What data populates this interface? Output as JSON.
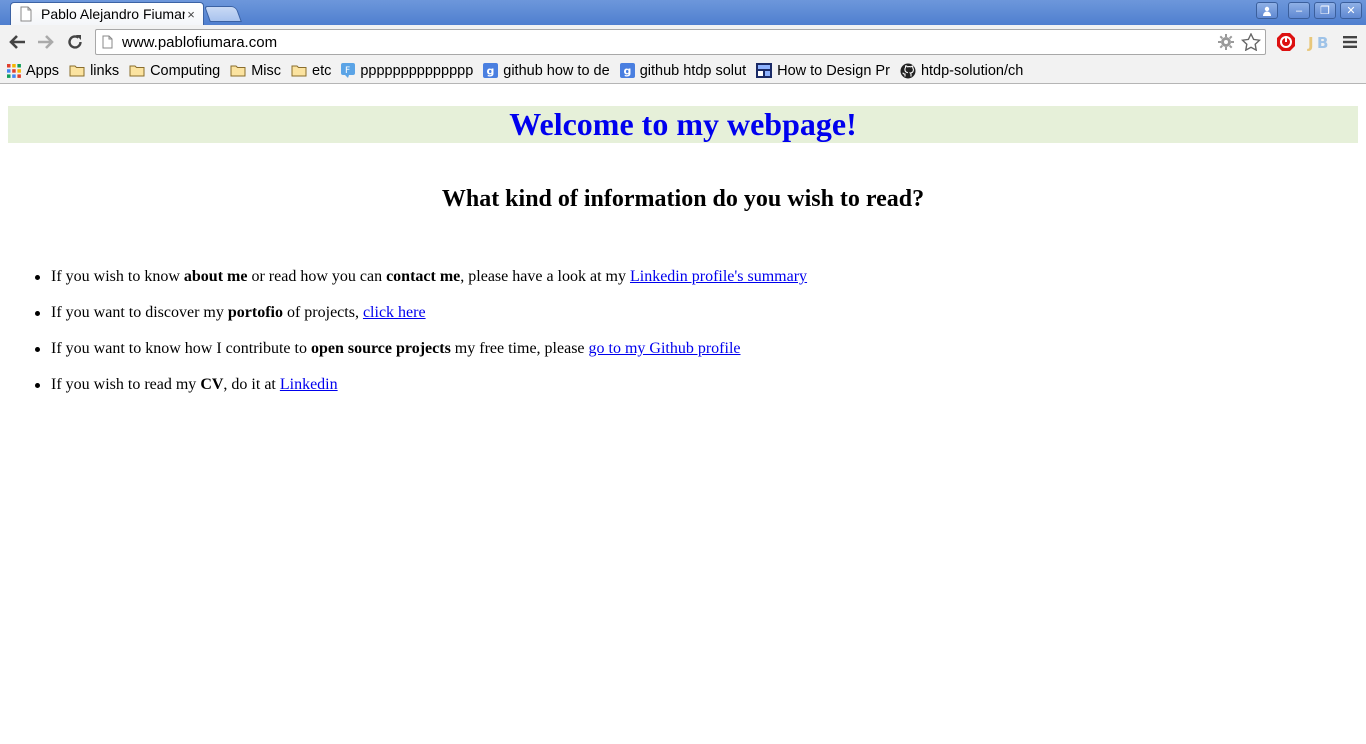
{
  "browser": {
    "tab_title": "Pablo Alejandro Fiumara",
    "tab_close": "×",
    "url": "www.pablofiumara.com",
    "window_buttons": {
      "minimize": "–",
      "restore": "❐",
      "close": "✕"
    }
  },
  "bookmarks": [
    {
      "label": "Apps",
      "icon": "apps-grid-icon"
    },
    {
      "label": "links",
      "icon": "folder-icon"
    },
    {
      "label": "Computing",
      "icon": "folder-icon"
    },
    {
      "label": "Misc",
      "icon": "folder-icon"
    },
    {
      "label": "etc",
      "icon": "folder-icon"
    },
    {
      "label": "pppppppppppppp",
      "icon": "feedly-icon"
    },
    {
      "label": "github how to de",
      "icon": "google-icon"
    },
    {
      "label": "github htdp solut",
      "icon": "google-icon"
    },
    {
      "label": "How to Design Pr",
      "icon": "htdp-icon"
    },
    {
      "label": "htdp-solution/ch",
      "icon": "github-icon"
    }
  ],
  "page": {
    "heading": "Welcome to my webpage!",
    "question": "What kind of information do you wish to read?",
    "items": [
      {
        "t1": "If you wish to know ",
        "b1": "about me",
        "t2": " or read how you can ",
        "b2": "contact me",
        "t3": ", please have a look at my ",
        "link": "Linkedin profile's summary"
      },
      {
        "t1": "If you want to discover my ",
        "b1": "portofio",
        "t2": " of projects, ",
        "link": "click here"
      },
      {
        "t1": "If you want to know how I contribute to ",
        "b1": "open source projects",
        "t2": " my free time, please ",
        "link": "go to my Github profile"
      },
      {
        "t1": "If you wish to read my ",
        "b1": "CV",
        "t2": ", do it at ",
        "link": "Linkedin"
      }
    ]
  },
  "colors": {
    "banner_bg": "#e6f0d9",
    "heading": "#0000ee",
    "link": "#0000ee",
    "titlebar": "#5a88d6"
  }
}
